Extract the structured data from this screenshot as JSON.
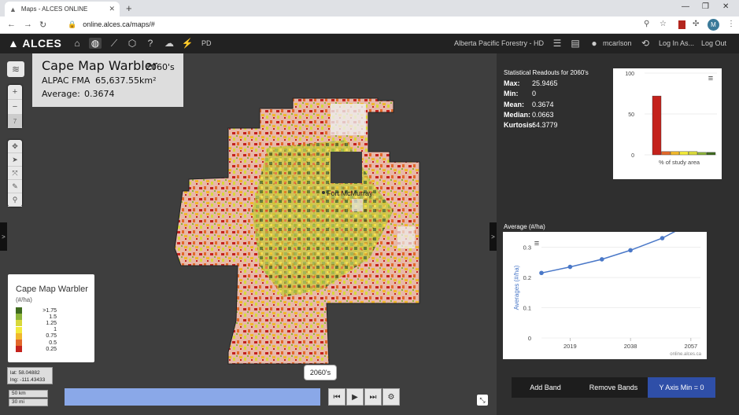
{
  "browser": {
    "tab_title": "Maps - ALCES ONLINE",
    "url": "online.alces.ca/maps/#",
    "profile_initial": "M"
  },
  "appbar": {
    "logo": "ALCES",
    "pd_label": "PD",
    "project": "Alberta Pacific Forestry - HD",
    "user": "mcarlson",
    "login_as": "Log In As...",
    "logout": "Log Out"
  },
  "title_box": {
    "species": "Cape Map Warbler",
    "period": "2060's",
    "area_name": "ALPAC FMA",
    "area_value": "65,637.55km²",
    "average_label": "Average:",
    "average_value": "0.3674"
  },
  "map": {
    "zoom_level": "7",
    "place_label": "Fort McMurray",
    "period_badge": "2060's",
    "lat": "lat: 58.04882",
    "lng": "lng: -111.43433",
    "scale_km": "50 km",
    "scale_mi": "30 mi"
  },
  "legend": {
    "title": "Cape Map Warbler",
    "unit": "(#/ha)",
    "rows": [
      {
        "label": ">1.75",
        "color": "#3f6b1e"
      },
      {
        "label": "1.5",
        "color": "#8db43a"
      },
      {
        "label": "1.25",
        "color": "#d8d83a"
      },
      {
        "label": "1",
        "color": "#f2ea3a"
      },
      {
        "label": "0.75",
        "color": "#f0b72c"
      },
      {
        "label": "0.5",
        "color": "#e2682a"
      },
      {
        "label": "0.25",
        "color": "#c4221c"
      }
    ]
  },
  "stats": {
    "title": "Statistical Readouts for 2060's",
    "rows": [
      {
        "key": "Max:",
        "value": "25.9465"
      },
      {
        "key": "Min:",
        "value": "0"
      },
      {
        "key": "Mean:",
        "value": "0.3674"
      },
      {
        "key": "Median:",
        "value": "0.0663"
      },
      {
        "key": "Kurtosis:",
        "value": "64.3779"
      }
    ]
  },
  "avg_chart_title": "Average (#/ha)",
  "chart_data": [
    {
      "type": "bar",
      "xlabel": "% of study area",
      "ylim": [
        0,
        100
      ],
      "yticks": [
        "100",
        "50",
        "0"
      ],
      "values": [
        72,
        4,
        4,
        4,
        4,
        3,
        3
      ],
      "colors": [
        "#c4221c",
        "#e2682a",
        "#f0b72c",
        "#f2ea3a",
        "#d8d83a",
        "#8db43a",
        "#3f6b1e"
      ]
    },
    {
      "type": "line",
      "ylabel": "Averages (#/ha)",
      "x": [
        2010,
        2019,
        2029,
        2038,
        2048,
        2057
      ],
      "values": [
        0.215,
        0.235,
        0.26,
        0.29,
        0.33,
        0.38
      ],
      "xticks": [
        "2019",
        "2038",
        "2057"
      ],
      "yticks": [
        "0.3",
        "0.2",
        "0.1",
        "0"
      ],
      "ylim": [
        0,
        0.33
      ],
      "credit": "online.alces.ca",
      "color": "#4a78c8"
    }
  ],
  "buttons": {
    "add_band": "Add Band",
    "remove_bands": "Remove Bands",
    "y_axis_min": "Y Axis Min = 0"
  }
}
